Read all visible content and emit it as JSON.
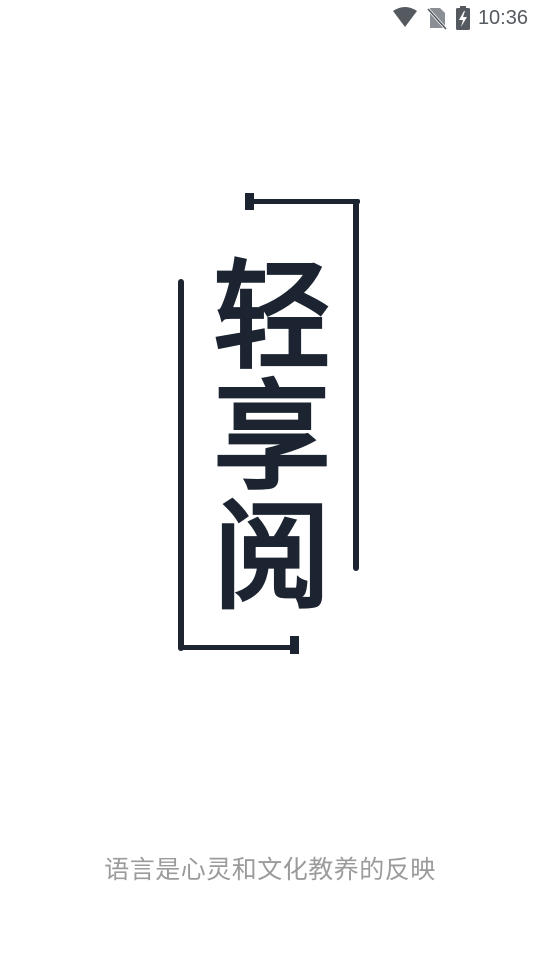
{
  "status_bar": {
    "time": "10:36",
    "icons": [
      "wifi-icon",
      "no-sim-icon",
      "battery-charging-icon"
    ]
  },
  "splash": {
    "logo_text": "轻享阅",
    "tagline": "语言是心灵和文化教养的反映"
  },
  "colors": {
    "background": "#ffffff",
    "logo": "#1b2430",
    "tagline": "#9b9b9b",
    "status": "#555a60"
  }
}
